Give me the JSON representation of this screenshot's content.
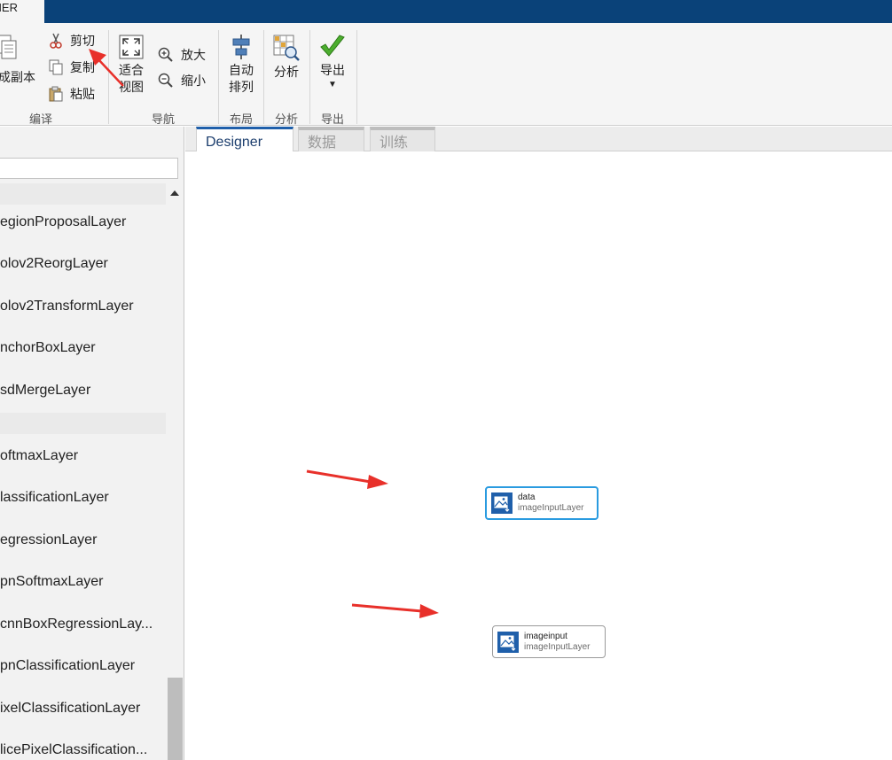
{
  "app_tab": {
    "label": "NER"
  },
  "toolstrip": {
    "sections": {
      "compile": "编译",
      "navigation": "导航",
      "layout": "布局",
      "analysis": "分析",
      "export": "导出"
    },
    "buttons": {
      "duplicate": "成副本",
      "cut": "剪切",
      "copy": "复制",
      "paste": "粘贴",
      "fit_view_line1": "适合",
      "fit_view_line2": "视图",
      "zoom_in": "放大",
      "zoom_out": "缩小",
      "auto_arrange_line1": "自动",
      "auto_arrange_line2": "排列",
      "analyze": "分析",
      "export": "导出"
    }
  },
  "palette": {
    "search": {
      "value": "",
      "placeholder": ""
    },
    "layers": [
      "egionProposalLayer",
      "olov2ReorgLayer",
      "olov2TransformLayer",
      "nchorBoxLayer",
      "sdMergeLayer",
      "oftmaxLayer",
      "lassificationLayer",
      "egressionLayer",
      "pnSoftmaxLayer",
      "cnnBoxRegressionLay...",
      "pnClassificationLayer",
      "ixelClassificationLayer",
      "licePixelClassification..."
    ]
  },
  "doc_tabs": [
    "Designer",
    "数据",
    "训练"
  ],
  "canvas": {
    "nodes": [
      {
        "name": "data",
        "type": "imageInputLayer",
        "selected": true
      },
      {
        "name": "imageinput",
        "type": "imageInputLayer",
        "selected": false
      }
    ]
  },
  "colors": {
    "title_bar": "#0a4279",
    "selection": "#2a9be0",
    "annotation_arrow": "#e8302a",
    "node_icon": "#1f5faa"
  }
}
